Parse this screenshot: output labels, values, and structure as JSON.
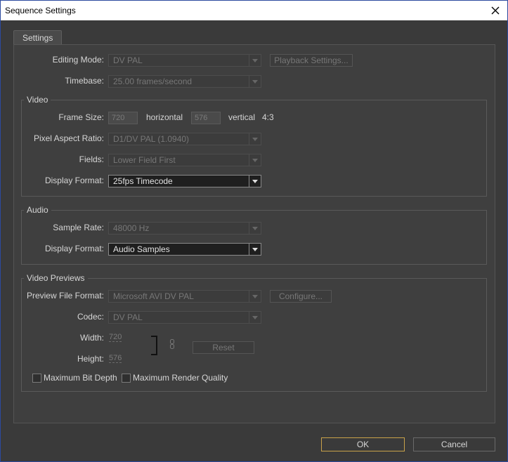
{
  "window": {
    "title": "Sequence Settings"
  },
  "tabs": [
    {
      "label": "Settings"
    }
  ],
  "general": {
    "editing_mode": {
      "label": "Editing Mode:",
      "value": "DV PAL"
    },
    "playback_button": "Playback Settings...",
    "timebase": {
      "label": "Timebase:",
      "value": "25.00 frames/second"
    }
  },
  "video": {
    "title": "Video",
    "frame_size": {
      "label": "Frame Size:",
      "width": "720",
      "horizontal_label": "horizontal",
      "height": "576",
      "vertical_label": "vertical",
      "aspect": "4:3"
    },
    "pixel_aspect_ratio": {
      "label": "Pixel Aspect Ratio:",
      "value": "D1/DV PAL (1.0940)"
    },
    "fields": {
      "label": "Fields:",
      "value": "Lower Field First"
    },
    "display_format": {
      "label": "Display Format:",
      "value": "25fps Timecode"
    }
  },
  "audio": {
    "title": "Audio",
    "sample_rate": {
      "label": "Sample Rate:",
      "value": "48000 Hz"
    },
    "display_format": {
      "label": "Display Format:",
      "value": "Audio Samples"
    }
  },
  "previews": {
    "title": "Video Previews",
    "preview_file_format": {
      "label": "Preview File Format:",
      "value": "Microsoft AVI DV PAL"
    },
    "configure_button": "Configure...",
    "codec": {
      "label": "Codec:",
      "value": "DV PAL"
    },
    "width": {
      "label": "Width:",
      "value": "720"
    },
    "height": {
      "label": "Height:",
      "value": "576"
    },
    "reset_button": "Reset",
    "max_bit_depth": {
      "label": "Maximum Bit Depth",
      "checked": false
    },
    "max_render_quality": {
      "label": "Maximum Render Quality",
      "checked": false
    }
  },
  "footer": {
    "ok": "OK",
    "cancel": "Cancel"
  },
  "icons": {
    "close": "close-icon",
    "dropdown": "chevron-down-icon",
    "link": "chain-link-icon"
  },
  "colors": {
    "background": "#3f3f3f",
    "ok_border": "#c9a24a"
  }
}
